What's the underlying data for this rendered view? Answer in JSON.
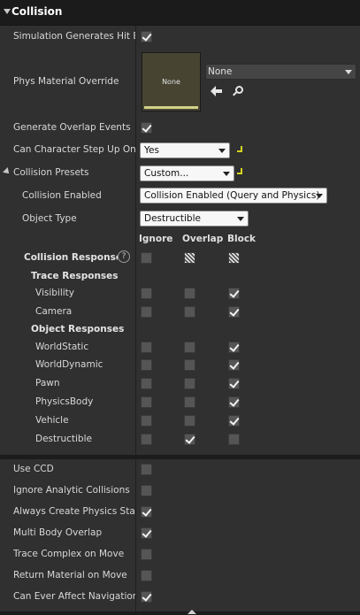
{
  "header": {
    "title": "Collision"
  },
  "rows": {
    "sim_hit": {
      "label": "Simulation Generates Hit Events",
      "checked": true
    },
    "phys_material": {
      "label": "Phys Material Override",
      "thumb_text": "None",
      "combo_value": "None"
    },
    "overlap_events": {
      "label": "Generate Overlap Events",
      "checked": true
    },
    "step_up": {
      "label": "Can Character Step Up On",
      "value": "Yes"
    },
    "presets": {
      "label": "Collision Presets",
      "value": "Custom..."
    },
    "collision_enabled": {
      "label": "Collision Enabled",
      "value": "Collision Enabled (Query and Physics)"
    },
    "object_type": {
      "label": "Object Type",
      "value": "Destructible"
    }
  },
  "responses": {
    "columns": [
      "Ignore",
      "Overlap",
      "Block"
    ],
    "header_label": "Collision Responses",
    "help_glyph": "?",
    "trace_header": "Trace Responses",
    "object_header": "Object Responses",
    "trace": [
      {
        "name": "Visibility",
        "state": "Block"
      },
      {
        "name": "Camera",
        "state": "Block"
      }
    ],
    "object": [
      {
        "name": "WorldStatic",
        "state": "Block"
      },
      {
        "name": "WorldDynamic",
        "state": "Block"
      },
      {
        "name": "Pawn",
        "state": "Block"
      },
      {
        "name": "PhysicsBody",
        "state": "Block"
      },
      {
        "name": "Vehicle",
        "state": "Block"
      },
      {
        "name": "Destructible",
        "state": "Overlap"
      }
    ]
  },
  "advanced": [
    {
      "label": "Use CCD",
      "checked": false
    },
    {
      "label": "Ignore Analytic Collisions",
      "checked": false
    },
    {
      "label": "Always Create Physics State",
      "checked": true
    },
    {
      "label": "Multi Body Overlap",
      "checked": true
    },
    {
      "label": "Trace Complex on Move",
      "checked": false
    },
    {
      "label": "Return Material on Move",
      "checked": false
    },
    {
      "label": "Can Ever Affect Navigation",
      "checked": true
    }
  ],
  "icons": {
    "header_toggle": "chevron-down-icon",
    "reset": "reset-to-default-icon",
    "back": "arrow-left-icon",
    "browse": "search-icon",
    "help": "help-icon"
  },
  "colors": {
    "panel_bg": "#303030",
    "header_bg": "#1b1b1b",
    "reset_accent": "#d6d41e"
  }
}
